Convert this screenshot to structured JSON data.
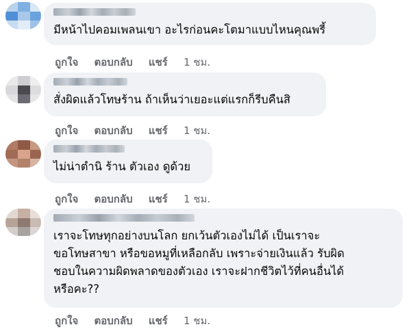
{
  "comments": [
    {
      "text_lines": [
        "มีหน้าไปคอมเพลนเขา อะไรก่อนคะโตมาแบบไหนคุณพรี้"
      ],
      "actions": {
        "like": "ถูกใจ",
        "reply": "ตอบกลับ",
        "share": "แชร์",
        "time": "1 ชม."
      }
    },
    {
      "text_lines": [
        "สั่งผิดแล้วโทษร้าน ถ้าเห็นว่าเยอะแต่แรกก็รีบคืนสิ"
      ],
      "actions": {
        "like": "ถูกใจ",
        "reply": "ตอบกลับ",
        "share": "แชร์",
        "time": "1 ชม."
      }
    },
    {
      "text_lines": [
        "ไม่น่าตำนิ ร้าน ตัวเอง ดูด้วย"
      ],
      "actions": {
        "like": "ถูกใจ",
        "reply": "ตอบกลับ",
        "share": "แชร์",
        "time": "1 ชม."
      }
    },
    {
      "text_lines": [
        "เราจะโทษทุกอย่างบนโลก ยกเว้นตัวเองไม่ได้ เป็นเราจะ",
        "ขอโทษสาขา หรือขอหมูที่เหลือกลับ เพราะจ่ายเงินแล้ว รับผิด",
        "ชอบในความผิดพลาดของตัวเอง เราจะฝากชีวิตไว้ที่คนอื่นได้",
        "หรือคะ??"
      ],
      "actions": {
        "like": "ถูกใจ",
        "reply": "ตอบกลับ",
        "share": "แชร์",
        "time": "1 ชม."
      }
    }
  ],
  "colors": {
    "bubble": "#f0f2f5",
    "text": "#050505",
    "action": "#65676b"
  }
}
